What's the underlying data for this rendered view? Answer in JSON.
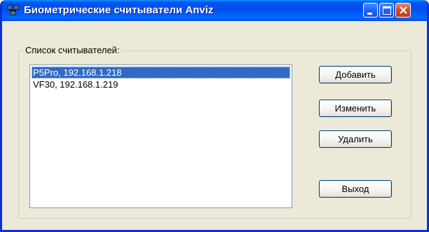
{
  "window": {
    "title": "Биометрические считыватели Anviz",
    "icon": "network-computers-icon",
    "controls": {
      "minimize": "minimize-icon",
      "maximize": "maximize-icon",
      "close": "close-icon"
    }
  },
  "group": {
    "label": "Список считывателей:"
  },
  "readers": [
    {
      "label": "P5Pro, 192.168.1.218",
      "selected": true
    },
    {
      "label": "VF30, 192.168.1.219",
      "selected": false
    }
  ],
  "buttons": {
    "add": "Добавить",
    "edit": "Изменить",
    "delete": "Удалить",
    "exit": "Выход"
  },
  "colors": {
    "titlebar": "#0053ee",
    "selection": "#316ac5",
    "dialog_bg": "#ece9d8",
    "close_button": "#d8492a"
  }
}
